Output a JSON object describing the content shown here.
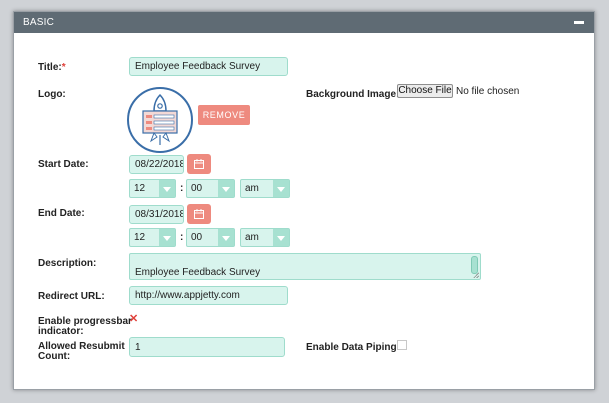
{
  "panel": {
    "title": "BASIC",
    "collapse_symbol": ""
  },
  "fields": {
    "title": {
      "label": "Title:",
      "required_mark": "*",
      "value": "Employee Feedback Survey"
    },
    "logo": {
      "label": "Logo:",
      "remove_label": "REMOVE",
      "icon": "rocket-survey-icon"
    },
    "background_image": {
      "label": "Background Image:",
      "button_label": "Choose File",
      "status": "No file chosen"
    },
    "start_date": {
      "label": "Start Date:",
      "date": "08/22/2018",
      "hour": "12",
      "minute": "00",
      "ampm": "am",
      "separator": ":"
    },
    "end_date": {
      "label": "End Date:",
      "date": "08/31/2018",
      "hour": "12",
      "minute": "00",
      "ampm": "am",
      "separator": ":"
    },
    "description": {
      "label": "Description:",
      "value": "Employee Feedback Survey"
    },
    "redirect_url": {
      "label": "Redirect URL:",
      "value": "http://www.appjetty.com"
    },
    "progressbar": {
      "label_line1": "Enable progressbar",
      "label_line2": "indicator:",
      "checked": true,
      "mark": "✕"
    },
    "resubmit": {
      "label_line1": "Allowed Resubmit",
      "label_line2": "Count:",
      "value": "1"
    },
    "data_piping": {
      "label": "Enable Data Piping:",
      "checked": false
    }
  },
  "colors": {
    "header_bg": "#5f6b74",
    "input_bg": "#d8f4ed",
    "input_border": "#9fdccc",
    "accent_salmon": "#ee8a7f",
    "required_red": "#e0403a",
    "logo_blue": "#3a6ea8"
  }
}
